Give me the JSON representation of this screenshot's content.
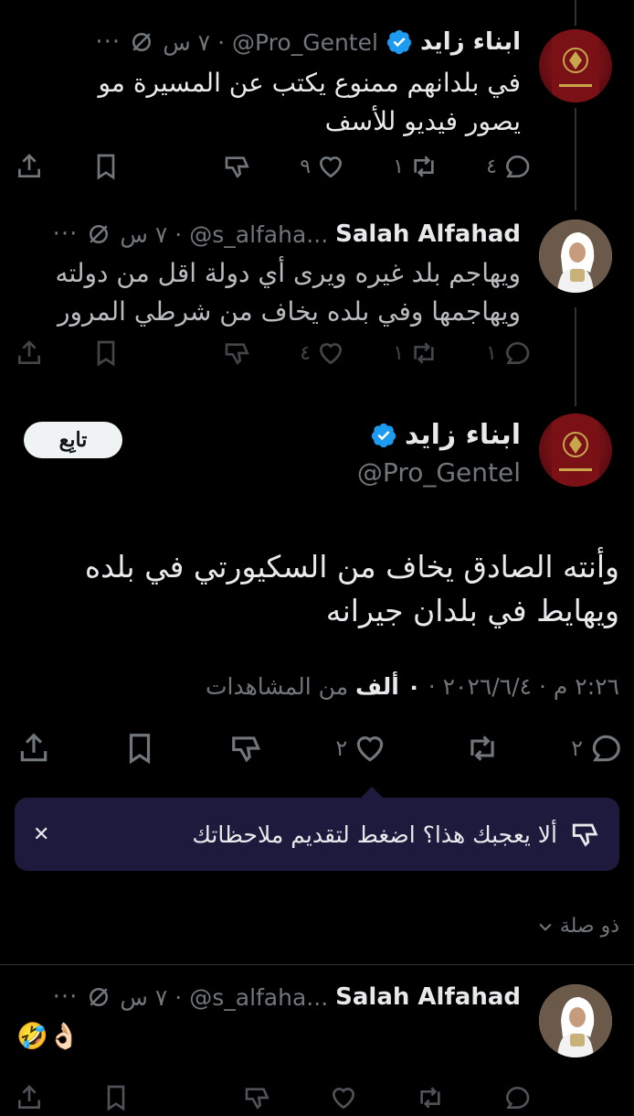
{
  "tweet1": {
    "name": "ابناء زايد",
    "handle": "@Pro_Gentel",
    "time": "٧ س",
    "text_line1": "في بلدانهم ممنوع يكتب عن المسيرة مو",
    "text_line2": "يصور فيديو للأسف",
    "replies": "٤",
    "retweets": "١",
    "likes": "٩"
  },
  "tweet2": {
    "name": "Salah Alfahad",
    "handle": "@s_alfaha...",
    "time": "٧ س",
    "text_line1": "ويهاجم بلد غيره ويرى أي دولة اقل من دولته",
    "text_line2": "ويهاجمها وفي بلده يخاف من شرطي المرور",
    "replies": "١",
    "retweets": "١",
    "likes": "٤"
  },
  "main_tweet": {
    "name": "ابناء زايد",
    "handle": "@Pro_Gentel",
    "follow_label": "تابِع",
    "text_line1": "وأنته الصادق يخاف من السكيورتي في بلده",
    "text_line2": "ويهايط في بلدان جيرانه",
    "meta_prefix": "٢:٢٦ م · ٢٠٢٦/٦/٤ · ",
    "views_count": "٠ ألف",
    "views_label": " من المشاهدات",
    "replies": "٢",
    "retweets": "",
    "likes": "٢"
  },
  "feedback_prompt": {
    "text": "ألا يعجبك هذا؟ اضغط لتقديم ملاحظاتك",
    "close": "✕"
  },
  "relevance": {
    "label": "ذو صلة"
  },
  "tweet3": {
    "name": "Salah Alfahad",
    "handle": "@s_alfaha...",
    "time": "٧ س",
    "text": "🤣👌🏻"
  },
  "colors": {
    "background": "#000000",
    "text": "#e7e9ea",
    "muted": "#71767b",
    "verified": "#1d9bf0",
    "prompt_bg": "#1e1a3d"
  }
}
